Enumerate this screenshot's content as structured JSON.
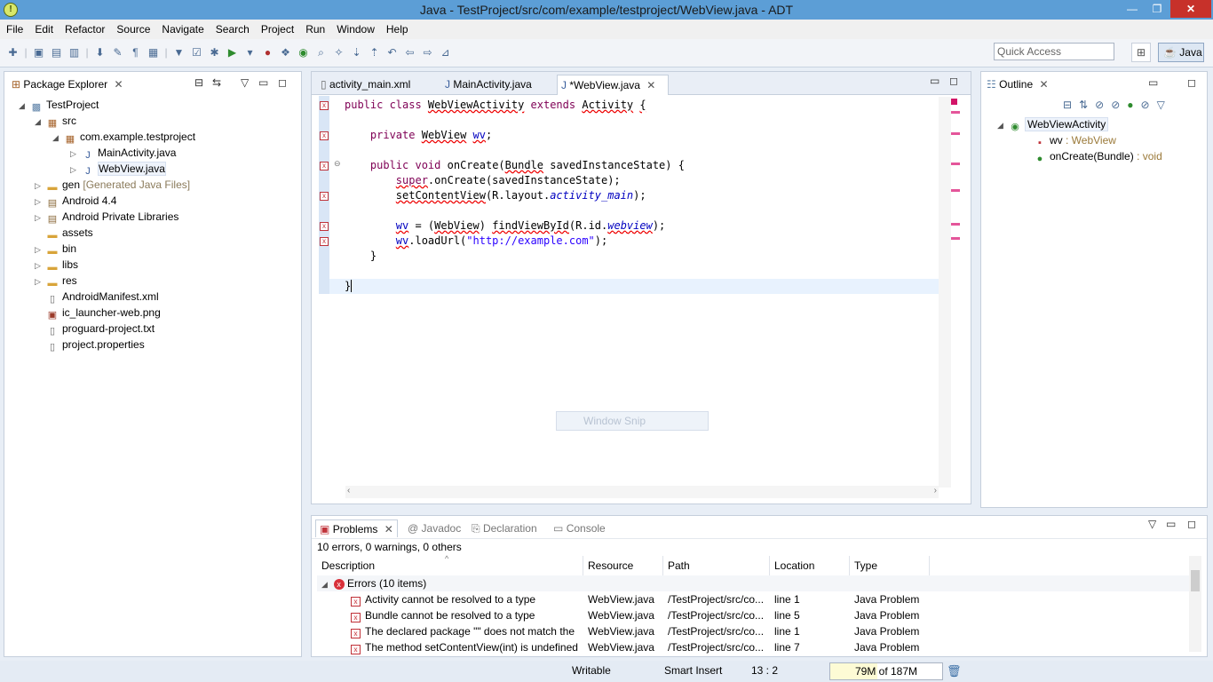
{
  "window": {
    "title": "Java - TestProject/src/com/example/testproject/WebView.java - ADT",
    "min": "—",
    "max": "❐",
    "close": "✕"
  },
  "menu": [
    "File",
    "Edit",
    "Refactor",
    "Source",
    "Navigate",
    "Search",
    "Project",
    "Run",
    "Window",
    "Help"
  ],
  "toolbar": {
    "quick_access_placeholder": "Quick Access",
    "perspective": "Java"
  },
  "package_explorer": {
    "title": "Package Explorer",
    "items": [
      {
        "label": "TestProject",
        "extra": "",
        "icon": "project-icon"
      },
      {
        "label": "src",
        "extra": "",
        "icon": "source-folder-icon"
      },
      {
        "label": "com.example.testproject",
        "extra": "",
        "icon": "package-icon"
      },
      {
        "label": "MainActivity.java",
        "extra": "",
        "icon": "java-file-icon"
      },
      {
        "label": "WebView.java",
        "extra": "",
        "icon": "java-file-icon"
      },
      {
        "label": "gen",
        "extra": "[Generated Java Files]",
        "icon": "folder-icon"
      },
      {
        "label": "Android 4.4",
        "extra": "",
        "icon": "library-icon"
      },
      {
        "label": "Android Private Libraries",
        "extra": "",
        "icon": "library-icon"
      },
      {
        "label": "assets",
        "extra": "",
        "icon": "folder-icon"
      },
      {
        "label": "bin",
        "extra": "",
        "icon": "folder-icon"
      },
      {
        "label": "libs",
        "extra": "",
        "icon": "folder-icon"
      },
      {
        "label": "res",
        "extra": "",
        "icon": "folder-icon"
      },
      {
        "label": "AndroidManifest.xml",
        "extra": "",
        "icon": "file-icon"
      },
      {
        "label": "ic_launcher-web.png",
        "extra": "",
        "icon": "image-icon"
      },
      {
        "label": "proguard-project.txt",
        "extra": "",
        "icon": "file-icon"
      },
      {
        "label": "project.properties",
        "extra": "",
        "icon": "file-icon"
      }
    ]
  },
  "editor": {
    "tabs": [
      {
        "label": "activity_main.xml",
        "active": false
      },
      {
        "label": "MainActivity.java",
        "active": false
      },
      {
        "label": "*WebView.java",
        "active": true
      }
    ]
  },
  "outline": {
    "title": "Outline",
    "class_name": "WebViewActivity",
    "members": [
      {
        "name": "wv",
        "type": " : WebView"
      },
      {
        "name": "onCreate(Bundle)",
        "type": " : void"
      }
    ]
  },
  "bottom_tabs": [
    {
      "label": "Problems",
      "active": true
    },
    {
      "label": "Javadoc",
      "active": false
    },
    {
      "label": "Declaration",
      "active": false
    },
    {
      "label": "Console",
      "active": false
    }
  ],
  "problems": {
    "summary": "10 errors, 0 warnings, 0 others",
    "columns": [
      "Description",
      "Resource",
      "Path",
      "Location",
      "Type"
    ],
    "group_label": "Errors (10 items)",
    "rows": [
      {
        "description": "Activity cannot be resolved to a type",
        "resource": "WebView.java",
        "path": "/TestProject/src/co...",
        "location": "line 1",
        "type": "Java Problem"
      },
      {
        "description": "Bundle cannot be resolved to a type",
        "resource": "WebView.java",
        "path": "/TestProject/src/co...",
        "location": "line 5",
        "type": "Java Problem"
      },
      {
        "description": "The declared package \"\" does not match the",
        "resource": "WebView.java",
        "path": "/TestProject/src/co...",
        "location": "line 1",
        "type": "Java Problem"
      },
      {
        "description": "The method setContentView(int) is undefined",
        "resource": "WebView.java",
        "path": "/TestProject/src/co...",
        "location": "line 7",
        "type": "Java Problem"
      }
    ]
  },
  "status": {
    "writable": "Writable",
    "insert_mode": "Smart Insert",
    "position": "13 : 2",
    "heap": "79M of 187M",
    "heap_used_fraction": 0.42
  },
  "overlay": {
    "snip_label": "Window Snip"
  }
}
